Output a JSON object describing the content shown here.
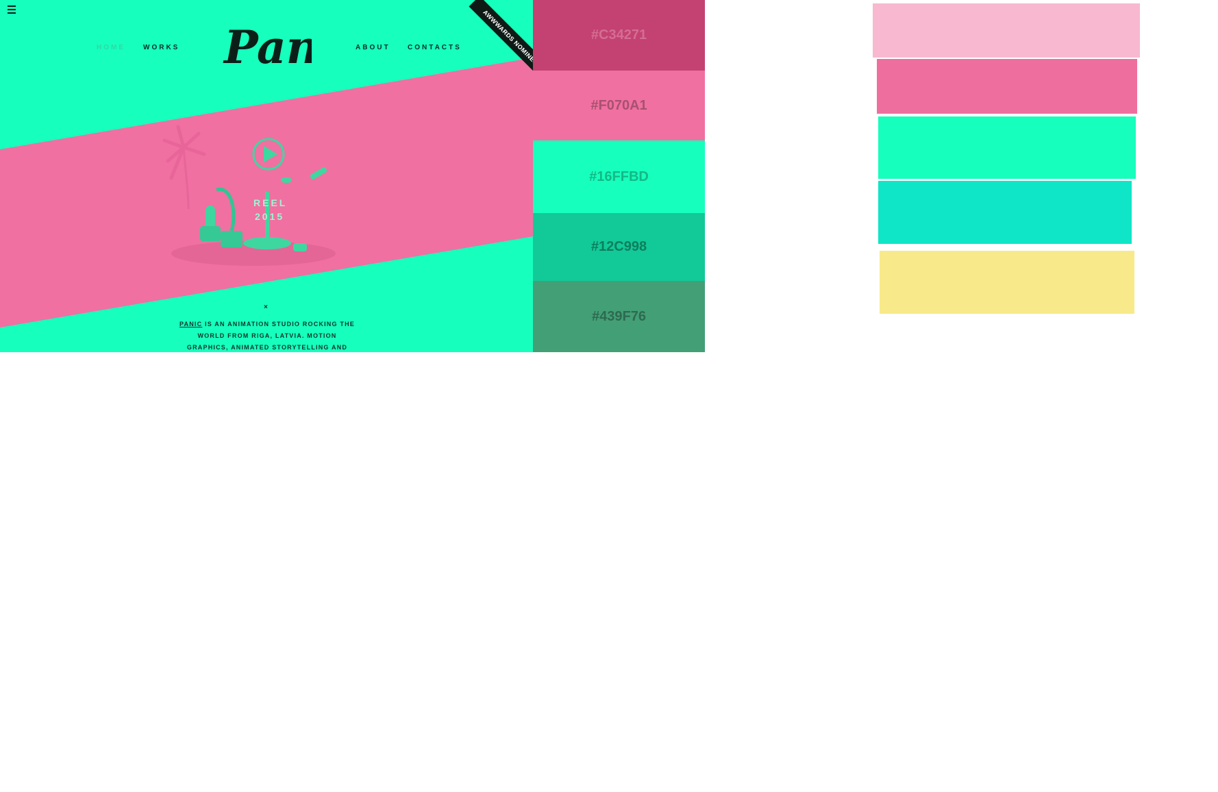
{
  "site": {
    "nav": {
      "home": "HOME",
      "works": "WORKS",
      "about": "ABOUT",
      "contacts": "CONTACTS"
    },
    "logo_text": "Panic",
    "awwwards": "AWWWARDS NOMINEE",
    "hero": {
      "reel_line1": "REEL",
      "reel_line2": "2015"
    },
    "close_symbol": "×",
    "about": {
      "brand": "PANIC",
      "text": " IS AN ANIMATION STUDIO ROCKING THE WORLD FROM RIGA, LATVIA. MOTION GRAPHICS, ANIMATED STORYTELLING AND"
    },
    "colors": {
      "mint": "#16FFBD",
      "pink": "#F070A1"
    }
  },
  "swatches": [
    {
      "hex": "#C34271"
    },
    {
      "hex": "#F070A1"
    },
    {
      "hex": "#16FFBD"
    },
    {
      "hex": "#12C998"
    },
    {
      "hex": "#439F76"
    }
  ],
  "palette_blocks": [
    {
      "color": "#F7B8D0"
    },
    {
      "color": "#EE6F9E"
    },
    {
      "color": "#16FFBD"
    },
    {
      "color": "#0FE6C8"
    },
    {
      "color": "#F8EA8A"
    }
  ]
}
